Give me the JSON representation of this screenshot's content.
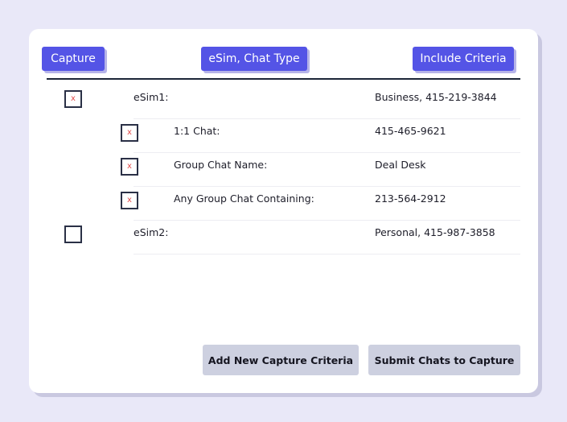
{
  "header": {
    "capture_label": "Capture",
    "esim_chat_type_label": "eSim, Chat Type",
    "include_criteria_label": "Include Criteria"
  },
  "rows": [
    {
      "label": "eSim1:",
      "value": "Business, 415-219-3844",
      "checked": true,
      "mark": "x"
    },
    {
      "label": "1:1 Chat:",
      "value": "415-465-9621",
      "checked": true,
      "mark": "x"
    },
    {
      "label": "Group Chat Name:",
      "value": "Deal Desk",
      "checked": true,
      "mark": "x"
    },
    {
      "label": "Any Group Chat Containing:",
      "value": "213-564-2912",
      "checked": true,
      "mark": "x"
    },
    {
      "label": "eSim2:",
      "value": "Personal, 415-987-3858",
      "checked": false,
      "mark": ""
    }
  ],
  "footer": {
    "add_label": "Add New Capture Criteria",
    "submit_label": "Submit Chats to Capture"
  },
  "colors": {
    "accent": "#5454e6",
    "background": "#e9e8f8",
    "secondary_button": "#cdd0e0",
    "check_mark": "#e24c4c"
  }
}
